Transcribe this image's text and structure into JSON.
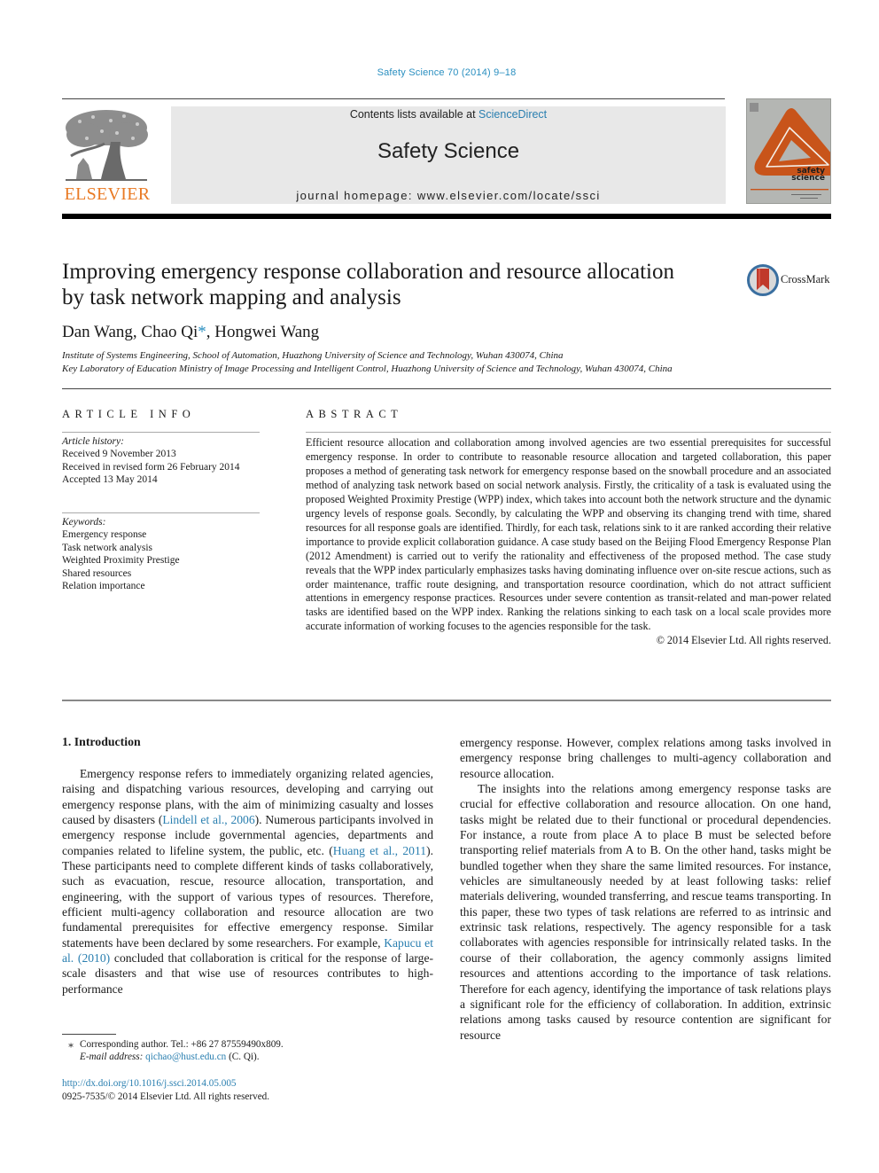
{
  "header": {
    "journal_ref": "Safety Science 70 (2014) 9–18",
    "contents_prefix": "Contents lists available at ",
    "contents_link": "ScienceDirect",
    "journal_title": "Safety Science",
    "homepage_prefix": "journal homepage: ",
    "homepage_url": "www.elsevier.com/locate/ssci",
    "publisher_logo_text": "ELSEVIER",
    "cover_title_line1": "safety",
    "cover_title_line2": "science",
    "colors": {
      "link": "#2a7fb0",
      "elsevier_orange": "#e97a24",
      "cover_orange": "#c8541a",
      "cover_gray": "#b4b6b3"
    }
  },
  "article": {
    "title_line1": "Improving emergency response collaboration and resource allocation",
    "title_line2": "by task network mapping and analysis",
    "crossmark_label": "CrossMark",
    "authors": [
      {
        "name": "Dan Wang",
        "sep": ", "
      },
      {
        "name": "Chao Qi",
        "mark": "*",
        "sep": ", "
      },
      {
        "name": "Hongwei Wang",
        "sep": ""
      }
    ],
    "affiliations": [
      "Institute of Systems Engineering, School of Automation, Huazhong University of Science and Technology, Wuhan 430074, China",
      "Key Laboratory of Education Ministry of Image Processing and Intelligent Control, Huazhong University of Science and Technology, Wuhan 430074, China"
    ]
  },
  "article_info": {
    "heading": "ARTICLE INFO",
    "history_label": "Article history:",
    "history": [
      "Received 9 November 2013",
      "Received in revised form 26 February 2014",
      "Accepted 13 May 2014"
    ],
    "keywords_label": "Keywords:",
    "keywords": [
      "Emergency response",
      "Task network analysis",
      "Weighted Proximity Prestige",
      "Shared resources",
      "Relation importance"
    ]
  },
  "abstract": {
    "heading": "ABSTRACT",
    "text": "Efficient resource allocation and collaboration among involved agencies are two essential prerequisites for successful emergency response. In order to contribute to reasonable resource allocation and targeted collaboration, this paper proposes a method of generating task network for emergency response based on the snowball procedure and an associated method of analyzing task network based on social network analysis. Firstly, the criticality of a task is evaluated using the proposed Weighted Proximity Prestige (WPP) index, which takes into account both the network structure and the dynamic urgency levels of response goals. Secondly, by calculating the WPP and observing its changing trend with time, shared resources for all response goals are identified. Thirdly, for each task, relations sink to it are ranked according their relative importance to provide explicit collaboration guidance. A case study based on the Beijing Flood Emergency Response Plan (2012 Amendment) is carried out to verify the rationality and effectiveness of the proposed method. The case study reveals that the WPP index particularly emphasizes tasks having dominating influence over on-site rescue actions, such as order maintenance, traffic route designing, and transportation resource coordination, which do not attract sufficient attentions in emergency response practices. Resources under severe contention as transit-related and man-power related tasks are identified based on the WPP index. Ranking the relations sinking to each task on a local scale provides more accurate information of working focuses to the agencies responsible for the task.",
    "copyright": "© 2014 Elsevier Ltd. All rights reserved."
  },
  "body": {
    "section_heading": "1. Introduction",
    "left_p1_a": "Emergency response refers to immediately organizing related agencies, raising and dispatching various resources, developing and carrying out emergency response plans, with the aim of minimizing casualty and losses caused by disasters (",
    "left_p1_cite1": "Lindell et al., 2006",
    "left_p1_b": "). Numerous participants involved in emergency response include governmental agencies, departments and companies related to lifeline system, the public, etc. (",
    "left_p1_cite2": "Huang et al., 2011",
    "left_p1_c": "). These participants need to complete different kinds of tasks collaboratively, such as evacuation, rescue, resource allocation, transportation, and engineering, with the support of various types of resources. Therefore, efficient multi-agency collaboration and resource allocation are two fundamental prerequisites for effective emergency response. Similar statements have been declared by some researchers. For example, ",
    "left_p1_cite3": "Kapucu et al. (2010)",
    "left_p1_d": " concluded that collaboration is critical for the response of large-scale disasters and that wise use of resources contributes to high-performance",
    "right_p1": "emergency response. However, complex relations among tasks involved in emergency response bring challenges to multi-agency collaboration and resource allocation.",
    "right_p2": "The insights into the relations among emergency response tasks are crucial for effective collaboration and resource allocation. On one hand, tasks might be related due to their functional or procedural dependencies. For instance, a route from place A to place B must be selected before transporting relief materials from A to B. On the other hand, tasks might be bundled together when they share the same limited resources. For instance, vehicles are simultaneously needed by at least following tasks: relief materials delivering, wounded transferring, and rescue teams transporting. In this paper, these two types of task relations are referred to as intrinsic and extrinsic task relations, respectively. The agency responsible for a task collaborates with agencies responsible for intrinsically related tasks. In the course of their collaboration, the agency commonly assigns limited resources and attentions according to the importance of task relations. Therefore for each agency, identifying the importance of task relations plays a significant role for the efficiency of collaboration. In addition, extrinsic relations among tasks caused by resource contention are significant for resource"
  },
  "footnotes": {
    "star": "⁎",
    "corresponding": "Corresponding author. Tel.: +86 27 87559490x809.",
    "email_label": "E-mail address:",
    "email": "qichao@hust.edu.cn",
    "email_suffix": " (C. Qi).",
    "doi": "http://dx.doi.org/10.1016/j.ssci.2014.05.005",
    "issn": "0925-7535/© 2014 Elsevier Ltd. All rights reserved."
  }
}
